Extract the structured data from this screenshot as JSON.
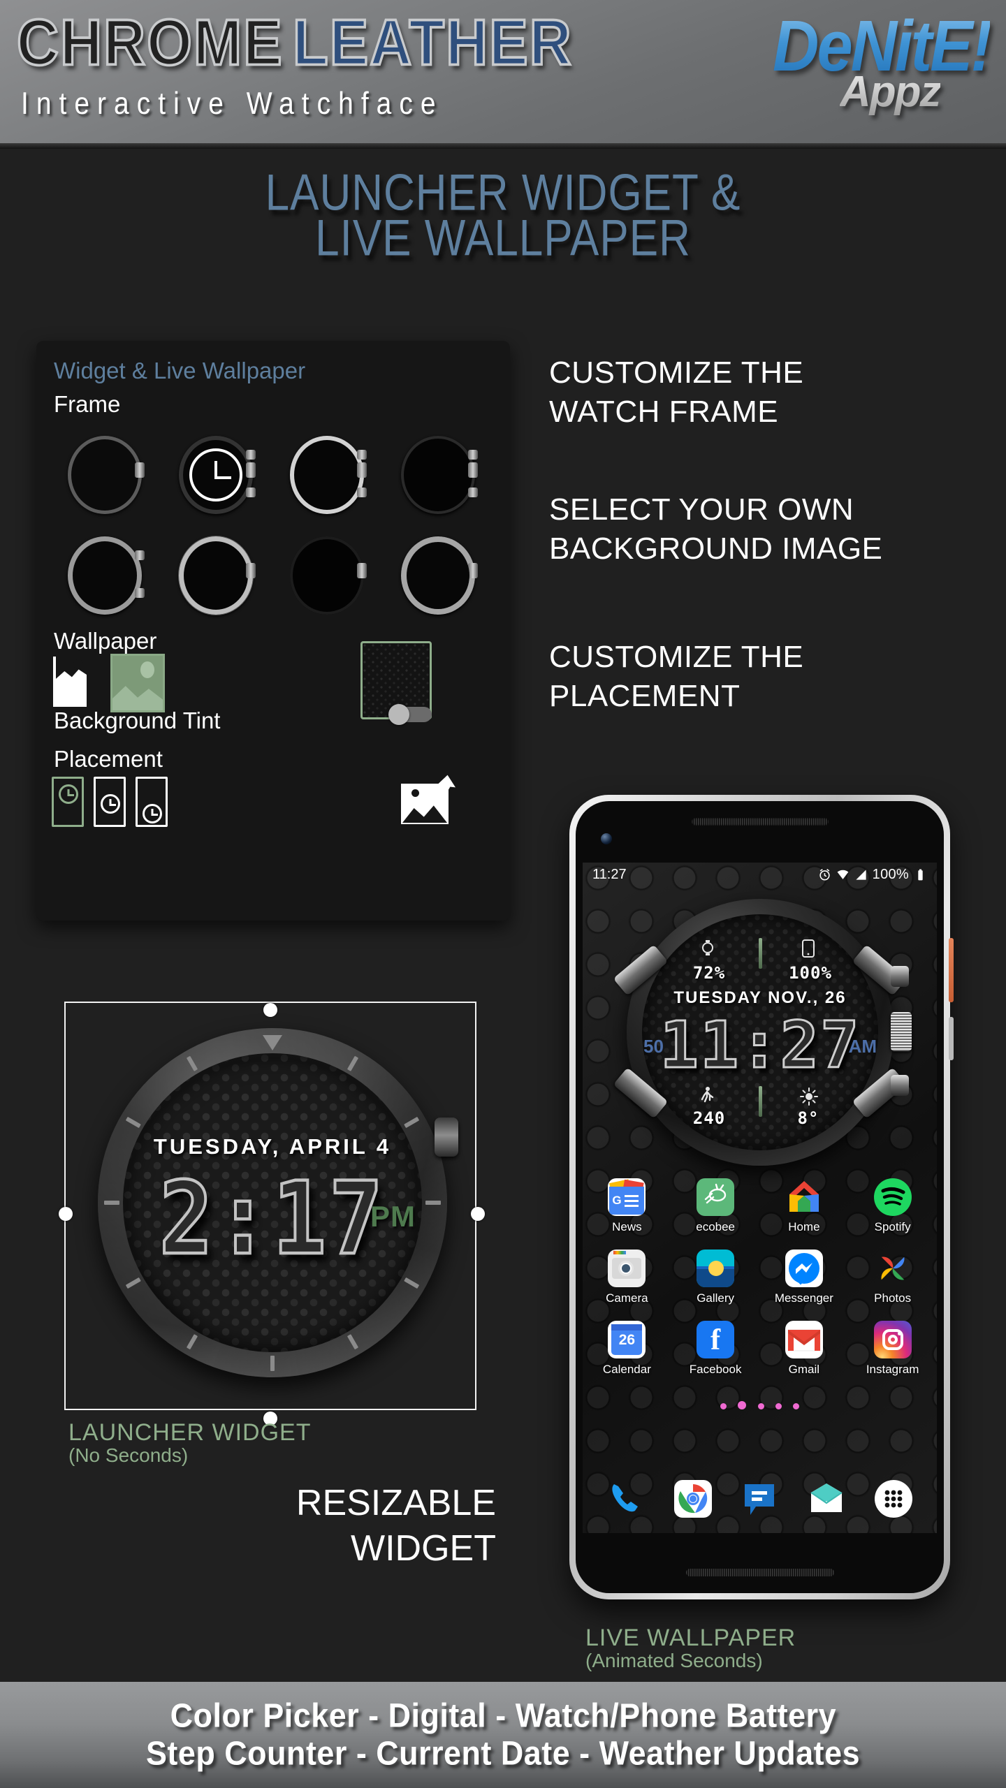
{
  "header": {
    "title_part1": "CHROME",
    "title_part2": "LEATHER",
    "subtitle": "Interactive Watchface",
    "logo_main": "DeNitE!",
    "logo_sub": "Appz"
  },
  "page_title": {
    "line1": "LAUNCHER WIDGET &",
    "line2": "LIVE WALLPAPER"
  },
  "settings_panel": {
    "title": "Widget & Live Wallpaper",
    "frame_label": "Frame",
    "wallpaper_label": "Wallpaper",
    "background_tint_label": "Background Tint",
    "placement_label": "Placement",
    "frames": [
      {
        "name": "frame-dark-bezel",
        "selected": false
      },
      {
        "name": "frame-clock-selected",
        "selected": true
      },
      {
        "name": "frame-chrome",
        "selected": false
      },
      {
        "name": "frame-black-steel",
        "selected": false
      },
      {
        "name": "frame-brushed-steel",
        "selected": false
      },
      {
        "name": "frame-studded",
        "selected": false
      },
      {
        "name": "frame-plain-black",
        "selected": false
      },
      {
        "name": "frame-knurled",
        "selected": false
      }
    ],
    "wallpaper_options": [
      {
        "name": "wallpaper-none",
        "selected": false
      },
      {
        "name": "wallpaper-image",
        "selected": true
      }
    ],
    "placement_options": [
      {
        "name": "placement-top",
        "selected": true
      },
      {
        "name": "placement-center",
        "selected": false
      },
      {
        "name": "placement-bottom",
        "selected": false
      }
    ],
    "tint_toggle_on": false,
    "accent_green": "#8fae8b",
    "accent_blue": "#5e7f9e"
  },
  "features": {
    "f1_line1": "CUSTOMIZE THE",
    "f1_line2": "WATCH FRAME",
    "f2_line1": "SELECT YOUR OWN",
    "f2_line2": "BACKGROUND IMAGE",
    "f3_line1": "CUSTOMIZE THE",
    "f3_line2": "PLACEMENT"
  },
  "launcher_widget": {
    "date": "TUESDAY, APRIL 4",
    "time": "2:17",
    "ampm": "PM",
    "caption_title": "LAUNCHER WIDGET",
    "caption_sub": "(No Seconds)",
    "resizable_line1": "RESIZABLE",
    "resizable_line2": "WIDGET"
  },
  "phone": {
    "statusbar": {
      "time": "11:27",
      "battery_pct": "100%",
      "icons": [
        "alarm-icon",
        "wifi-icon",
        "signal-icon",
        "battery-icon"
      ]
    },
    "watchface": {
      "watch_battery": "72%",
      "phone_battery": "100%",
      "date": "TUESDAY NOV., 26",
      "time": "11:27",
      "seconds": "50",
      "ampm": "AM",
      "steps": "240",
      "temperature": "8°"
    },
    "apps": [
      [
        {
          "label": "News",
          "icon": "google-news-icon"
        },
        {
          "label": "ecobee",
          "icon": "ecobee-icon"
        },
        {
          "label": "Home",
          "icon": "google-home-icon"
        },
        {
          "label": "Spotify",
          "icon": "spotify-icon"
        }
      ],
      [
        {
          "label": "Camera",
          "icon": "camera-icon"
        },
        {
          "label": "Gallery",
          "icon": "gallery-icon"
        },
        {
          "label": "Messenger",
          "icon": "messenger-icon"
        },
        {
          "label": "Photos",
          "icon": "google-photos-icon"
        }
      ],
      [
        {
          "label": "Calendar",
          "icon": "calendar-icon",
          "badge": "26"
        },
        {
          "label": "Facebook",
          "icon": "facebook-icon"
        },
        {
          "label": "Gmail",
          "icon": "gmail-icon"
        },
        {
          "label": "Instagram",
          "icon": "instagram-icon"
        }
      ]
    ],
    "dock": [
      {
        "name": "phone-icon"
      },
      {
        "name": "chrome-icon"
      },
      {
        "name": "messages-icon"
      },
      {
        "name": "email-icon"
      },
      {
        "name": "app-drawer-icon"
      }
    ],
    "page_dots": 5,
    "caption_title": "LIVE WALLPAPER",
    "caption_sub": "(Animated Seconds)"
  },
  "footer": {
    "line1": "Color Picker  -  Digital  -  Watch/Phone Battery",
    "line2": "Step Counter - Current Date - Weather Updates"
  }
}
